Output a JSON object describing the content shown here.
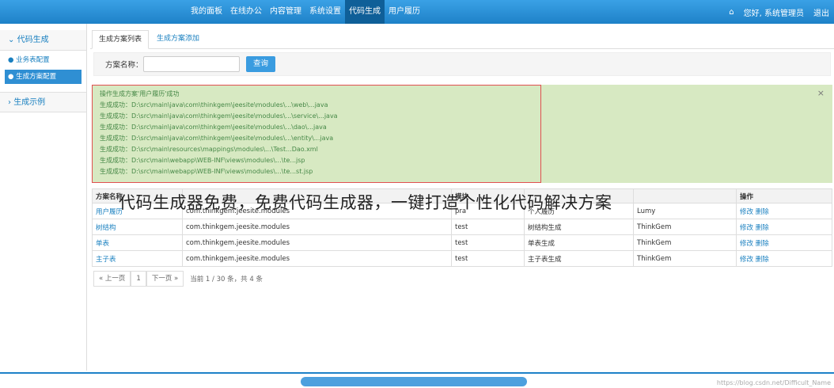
{
  "topnav": {
    "items": [
      "我的面板",
      "在线办公",
      "内容管理",
      "系统设置",
      "代码生成",
      "用户履历"
    ],
    "active_index": 4,
    "home_icon": "home-icon",
    "user": "您好, 系统管理员",
    "logout": "退出"
  },
  "sidebar": {
    "section1": "代码生成",
    "items": [
      "业务表配置",
      "生成方案配置"
    ],
    "active_item": 1,
    "section2": "生成示例"
  },
  "tabs": {
    "active": "生成方案列表",
    "other": "生成方案添加"
  },
  "search": {
    "label": "方案名称：",
    "value": "",
    "button": "查询"
  },
  "alert": {
    "lines": [
      "操作生成方案'用户履历'成功",
      "生成成功：D:\\src\\main\\java\\com\\thinkgem\\jeesite\\modules\\...\\web\\...java",
      "生成成功：D:\\src\\main\\java\\com\\thinkgem\\jeesite\\modules\\...\\service\\...java",
      "生成成功：D:\\src\\main\\java\\com\\thinkgem\\jeesite\\modules\\...\\dao\\...java",
      "生成成功：D:\\src\\main\\java\\com\\thinkgem\\jeesite\\modules\\...\\entity\\...java",
      "生成成功：D:\\src\\main\\resources\\mappings\\modules\\...\\Test...Dao.xml",
      "生成成功：D:\\src\\main\\webapp\\WEB-INF\\views\\modules\\...\\te...jsp",
      "生成成功：D:\\src\\main\\webapp\\WEB-INF\\views\\modules\\...\\te...st.jsp"
    ],
    "close": "×"
  },
  "table": {
    "headers": [
      "方案名称",
      "",
      "模块",
      "",
      "",
      "操作"
    ],
    "rows": [
      [
        "用户履历",
        "com.thinkgem.jeesite.modules",
        "pra",
        "个人履历",
        "Lumy",
        "修改 删除"
      ],
      [
        "树结构",
        "com.thinkgem.jeesite.modules",
        "test",
        "树结构生成",
        "ThinkGem",
        "修改 删除"
      ],
      [
        "单表",
        "com.thinkgem.jeesite.modules",
        "test",
        "单表生成",
        "ThinkGem",
        "修改 删除"
      ],
      [
        "主子表",
        "com.thinkgem.jeesite.modules",
        "test",
        "主子表生成",
        "ThinkGem",
        "修改 删除"
      ]
    ]
  },
  "pager": {
    "prev": "« 上一页",
    "page": "1",
    "next": "下一页 »",
    "info": "当前  1  /  30  条，共 4 条"
  },
  "overlay_text": "代码生成器免费，免费代码生成器，一键打造个性化代码解决方案",
  "watermark": "https://blog.csdn.net/Difficult_Name"
}
